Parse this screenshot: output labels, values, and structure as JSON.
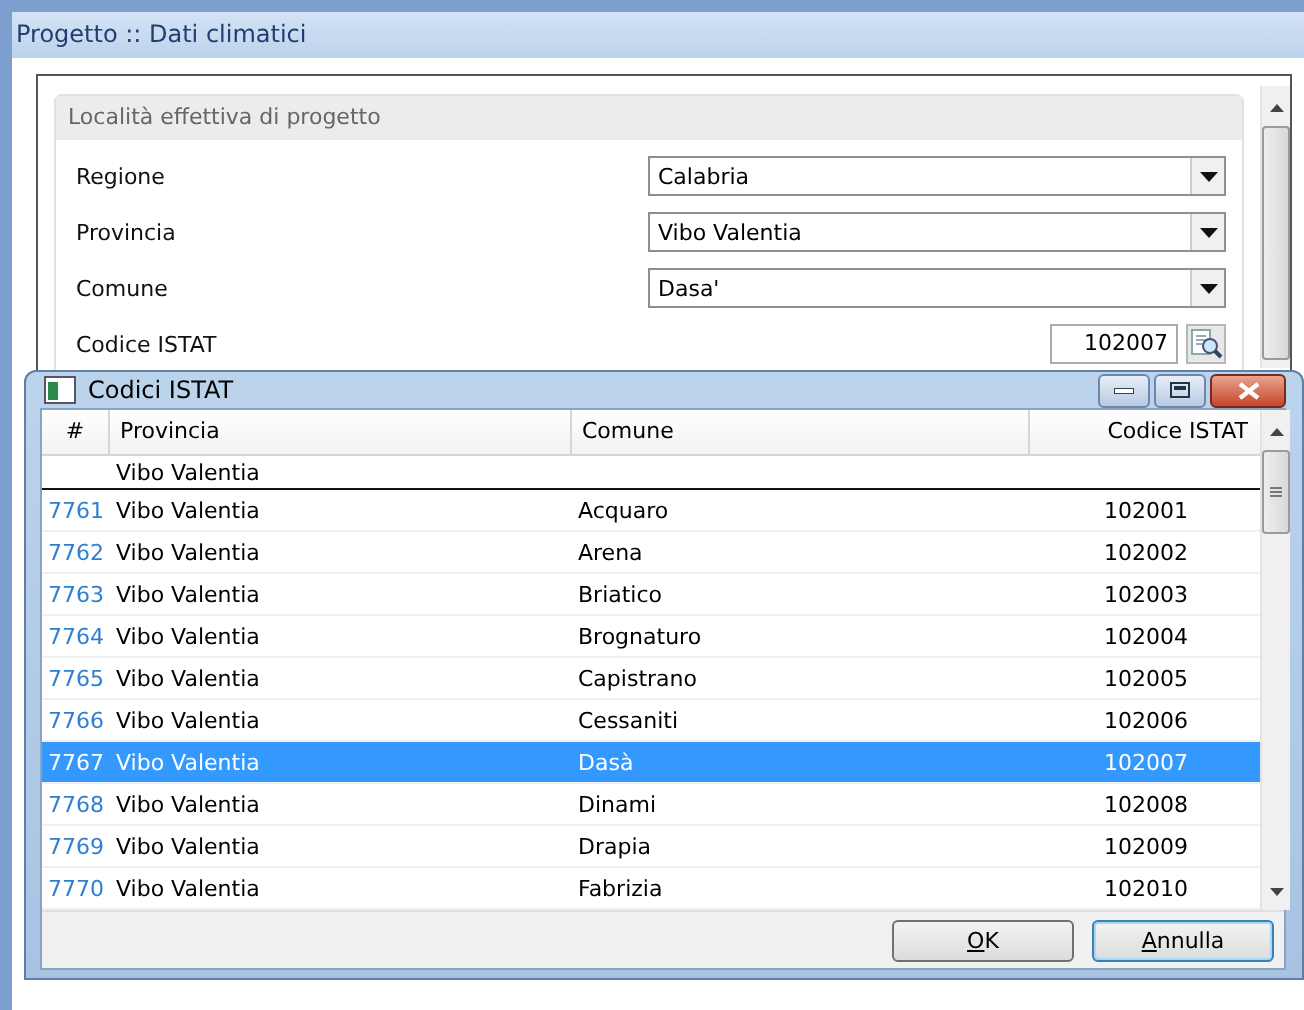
{
  "window": {
    "title": "Progetto :: Dati climatici"
  },
  "group": {
    "title": "Località effettiva di progetto",
    "fields": [
      {
        "kind": "combo",
        "label": "Regione",
        "value": "Calabria"
      },
      {
        "kind": "combo",
        "label": "Provincia",
        "value": "Vibo Valentia"
      },
      {
        "kind": "combo",
        "label": "Comune",
        "value": "Dasa'"
      },
      {
        "kind": "code",
        "label": "Codice ISTAT",
        "value": "102007"
      }
    ]
  },
  "dialog": {
    "title": "Codici ISTAT",
    "columns": [
      "#",
      "Provincia",
      "Comune",
      "Codice ISTAT"
    ],
    "filter": {
      "provincia": "Vibo Valentia"
    },
    "rows": [
      {
        "num": "7761",
        "provincia": "Vibo Valentia",
        "comune": "Acquaro",
        "codice": "102001",
        "selected": false
      },
      {
        "num": "7762",
        "provincia": "Vibo Valentia",
        "comune": "Arena",
        "codice": "102002",
        "selected": false
      },
      {
        "num": "7763",
        "provincia": "Vibo Valentia",
        "comune": "Briatico",
        "codice": "102003",
        "selected": false
      },
      {
        "num": "7764",
        "provincia": "Vibo Valentia",
        "comune": "Brognaturo",
        "codice": "102004",
        "selected": false
      },
      {
        "num": "7765",
        "provincia": "Vibo Valentia",
        "comune": "Capistrano",
        "codice": "102005",
        "selected": false
      },
      {
        "num": "7766",
        "provincia": "Vibo Valentia",
        "comune": "Cessaniti",
        "codice": "102006",
        "selected": false
      },
      {
        "num": "7767",
        "provincia": "Vibo Valentia",
        "comune": "Dasà",
        "codice": "102007",
        "selected": true
      },
      {
        "num": "7768",
        "provincia": "Vibo Valentia",
        "comune": "Dinami",
        "codice": "102008",
        "selected": false
      },
      {
        "num": "7769",
        "provincia": "Vibo Valentia",
        "comune": "Drapia",
        "codice": "102009",
        "selected": false
      },
      {
        "num": "7770",
        "provincia": "Vibo Valentia",
        "comune": "Fabrizia",
        "codice": "102010",
        "selected": false
      }
    ],
    "buttons": [
      {
        "label": "OK"
      },
      {
        "label": "Annulla"
      }
    ]
  }
}
